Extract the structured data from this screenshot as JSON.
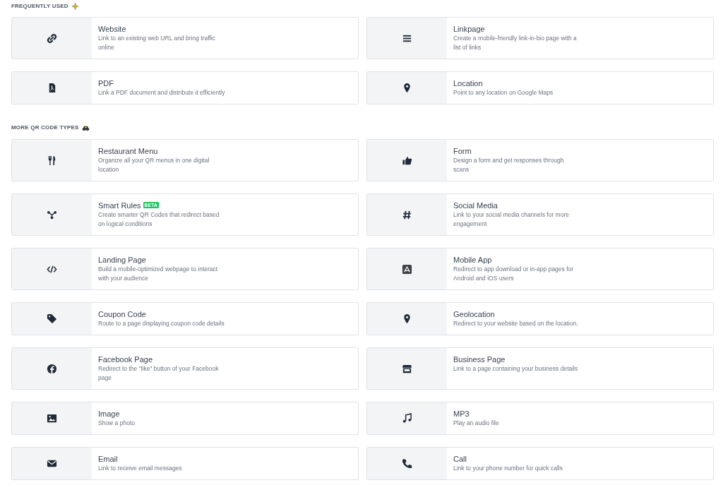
{
  "sections": [
    {
      "heading": "FREQUENTLY USED",
      "cards": [
        {
          "title": "Website",
          "description": "Link to an existing web URL and bring traffic online"
        },
        {
          "title": "Linkpage",
          "description": "Create a mobile-friendly link-in-bio page with a list of links"
        },
        {
          "title": "PDF",
          "description": "Link a PDF document and distribute it efficiently"
        },
        {
          "title": "Location",
          "description": "Point to any location on Google Maps"
        }
      ]
    },
    {
      "heading": "MORE QR CODE TYPES",
      "cards": [
        {
          "title": "Restaurant Menu",
          "description": "Organize all your QR menus in one digital location"
        },
        {
          "title": "Form",
          "description": "Design a form and get responses through scans"
        },
        {
          "title": "Smart Rules",
          "badge": "BETA",
          "description": "Create smarter QR Codes that redirect based on logical conditions"
        },
        {
          "title": "Social Media",
          "description": "Link to your social media channels for more engagement"
        },
        {
          "title": "Landing Page",
          "description": "Build a mobile-optimized webpage to interact with your audience"
        },
        {
          "title": "Mobile App",
          "description": "Redirect to app download or in-app pages for Android and iOS users"
        },
        {
          "title": "Coupon Code",
          "description": "Route to a page displaying coupon code details"
        },
        {
          "title": "Geolocation",
          "description": "Redirect to your website based on the location."
        },
        {
          "title": "Facebook Page",
          "description": "Redirect to the \"like\" button of your Facebook page"
        },
        {
          "title": "Business Page",
          "description": "Link to a page containing your business details"
        },
        {
          "title": "Image",
          "description": "Show a photo"
        },
        {
          "title": "MP3",
          "description": "Play an audio file"
        },
        {
          "title": "Email",
          "description": "Link to receive email messages"
        },
        {
          "title": "Call",
          "description": "Link to your phone number for quick calls"
        }
      ]
    }
  ]
}
